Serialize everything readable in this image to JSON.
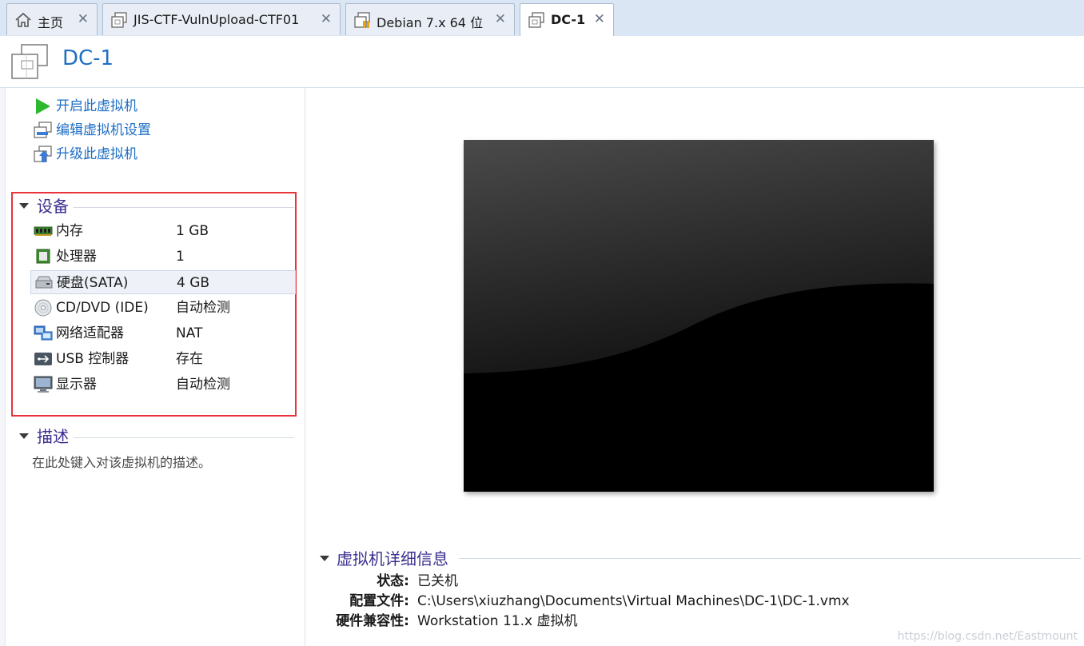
{
  "tabs": [
    {
      "label": "主页",
      "icon": "home-icon"
    },
    {
      "label": "JIS-CTF-VulnUpload-CTF01",
      "icon": "vm-icon"
    },
    {
      "label": "Debian 7.x 64 位",
      "icon": "vm-running-icon"
    },
    {
      "label": "DC-1",
      "icon": "vm-icon",
      "active": true
    }
  ],
  "tab_close_glyph": "✕",
  "header": {
    "title": "DC-1"
  },
  "actions": {
    "power_on": "开启此虚拟机",
    "edit_settings": "编辑虚拟机设置",
    "upgrade": "升级此虚拟机"
  },
  "devices": {
    "heading": "设备",
    "items": [
      {
        "name": "内存",
        "value": "1 GB",
        "icon": "memory-icon"
      },
      {
        "name": "处理器",
        "value": "1",
        "icon": "cpu-icon"
      },
      {
        "name": "硬盘(SATA)",
        "value": "4 GB",
        "icon": "hard-disk-icon"
      },
      {
        "name": "CD/DVD (IDE)",
        "value": "自动检测",
        "icon": "cd-dvd-icon"
      },
      {
        "name": "网络适配器",
        "value": "NAT",
        "icon": "network-adapter-icon"
      },
      {
        "name": "USB 控制器",
        "value": "存在",
        "icon": "usb-icon"
      },
      {
        "name": "显示器",
        "value": "自动检测",
        "icon": "display-icon"
      }
    ]
  },
  "description": {
    "heading": "描述",
    "placeholder": "在此处键入对该虚拟机的描述。"
  },
  "details": {
    "heading": "虚拟机详细信息",
    "status_label": "状态:",
    "status_value": "已关机",
    "config_label": "配置文件:",
    "config_value": "C:\\Users\\xiuzhang\\Documents\\Virtual Machines\\DC-1\\DC-1.vmx",
    "compat_label": "硬件兼容性:",
    "compat_value": "Workstation 11.x 虚拟机"
  },
  "watermark": "https://blog.csdn.net/Eastmount",
  "colors": {
    "accent": "#1f6fc5",
    "section": "#3a2f8f",
    "highlight_box": "#e8333a"
  }
}
